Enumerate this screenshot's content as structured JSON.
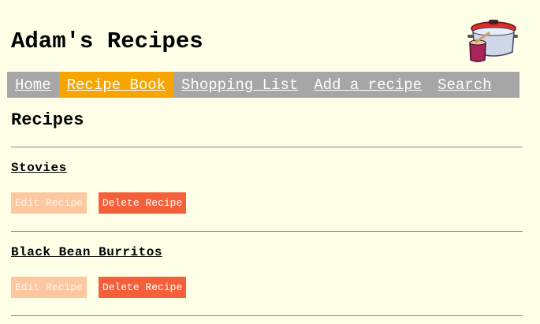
{
  "header": {
    "title": "Adam's Recipes"
  },
  "nav": {
    "items": [
      {
        "label": "Home",
        "active": false
      },
      {
        "label": "Recipe Book",
        "active": true
      },
      {
        "label": "Shopping List",
        "active": false
      },
      {
        "label": "Add a recipe",
        "active": false
      },
      {
        "label": "Search",
        "active": false
      }
    ]
  },
  "main": {
    "section_title": "Recipes",
    "recipes": [
      {
        "name": "Stovies",
        "edit_label": "Edit Recipe",
        "delete_label": "Delete Recipe"
      },
      {
        "name": "Black Bean Burritos",
        "edit_label": "Edit Recipe",
        "delete_label": "Delete Recipe"
      }
    ]
  },
  "colors": {
    "background": "#fffee6",
    "nav_bg": "#a6a6a6",
    "nav_active": "#f7a500",
    "delete_button": "#f5603a",
    "edit_button": "#fdc8a0"
  },
  "icons": {
    "logo": "cooking-pot-icon"
  }
}
